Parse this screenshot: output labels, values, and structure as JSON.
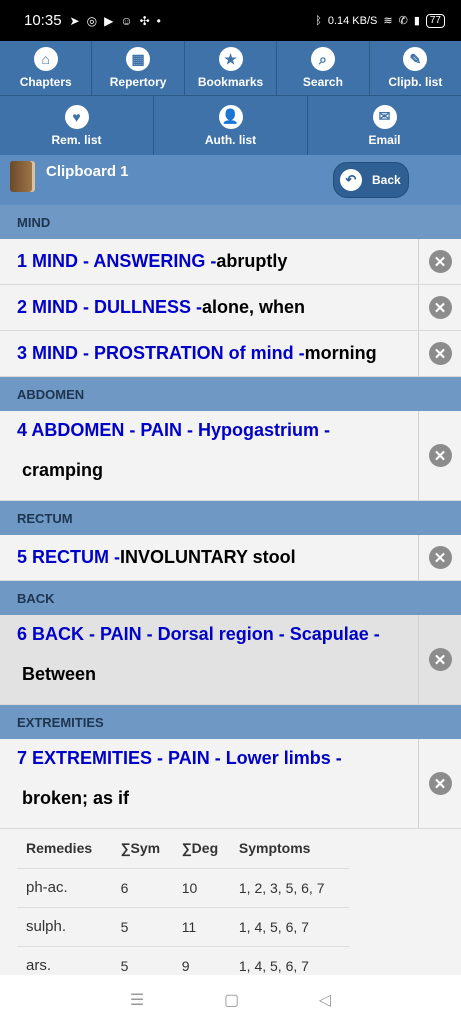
{
  "status": {
    "time": "10:35",
    "left_icons": [
      "send-icon",
      "instagram-icon",
      "youtube-icon",
      "snapchat-icon",
      "app-icon",
      "dot-icon"
    ],
    "net_speed": "0.14 KB/S",
    "battery": "77"
  },
  "nav": {
    "row1": [
      {
        "label": "Chapters",
        "icon": "home-icon",
        "glyph": "⌂"
      },
      {
        "label": "Repertory",
        "icon": "grid-icon",
        "glyph": "▦"
      },
      {
        "label": "Bookmarks",
        "icon": "star-icon",
        "glyph": "★"
      },
      {
        "label": "Search",
        "icon": "search-icon",
        "glyph": "⌕"
      },
      {
        "label": "Clipb. list",
        "icon": "pencil-icon",
        "glyph": "✎"
      }
    ],
    "row2": [
      {
        "label": "Rem. list",
        "icon": "heart-icon",
        "glyph": "♥"
      },
      {
        "label": "Auth. list",
        "icon": "person-icon",
        "glyph": "👤"
      },
      {
        "label": "Email",
        "icon": "mail-icon",
        "glyph": "✉"
      }
    ]
  },
  "clipboard": {
    "title": "Clipboard 1",
    "back_label": "Back"
  },
  "sections": [
    {
      "name": "MIND",
      "rows": [
        {
          "head": "1 MIND - ANSWERING - ",
          "tail": "abruptly",
          "layout": "single",
          "shaded": false
        },
        {
          "head": "2 MIND - DULLNESS - ",
          "tail": "alone, when",
          "layout": "single",
          "shaded": false
        },
        {
          "head": "3 MIND - PROSTRATION of mind - ",
          "tail": "morning",
          "layout": "single",
          "shaded": false
        }
      ]
    },
    {
      "name": "ABDOMEN",
      "rows": [
        {
          "head": "4 ABDOMEN - PAIN - Hypogastrium - ",
          "tail": "cramping",
          "layout": "double",
          "shaded": false
        }
      ]
    },
    {
      "name": "RECTUM",
      "rows": [
        {
          "head": "5 RECTUM - ",
          "tail": "INVOLUNTARY stool",
          "layout": "single",
          "shaded": false
        }
      ]
    },
    {
      "name": "BACK",
      "rows": [
        {
          "head": "6 BACK - PAIN - Dorsal region - Scapulae - ",
          "tail": "Between",
          "layout": "double",
          "shaded": true
        }
      ]
    },
    {
      "name": "EXTREMITIES",
      "rows": [
        {
          "head": "7 EXTREMITIES - PAIN - Lower limbs - ",
          "tail": "broken; as if",
          "layout": "double",
          "shaded": false
        }
      ]
    }
  ],
  "remedies": {
    "headers": [
      "Remedies",
      "∑Sym",
      "∑Deg",
      "Symptoms"
    ],
    "rows": [
      [
        "ph-ac.",
        "6",
        "10",
        "1, 2, 3, 5, 6, 7"
      ],
      [
        "sulph.",
        "5",
        "11",
        "1, 4, 5, 6, 7"
      ],
      [
        "ars.",
        "5",
        "9",
        "1, 4, 5, 6, 7"
      ]
    ]
  },
  "sysnav": [
    {
      "name": "recents-icon",
      "glyph": "☰"
    },
    {
      "name": "home-button-icon",
      "glyph": "▢"
    },
    {
      "name": "back-nav-icon",
      "glyph": "◁"
    }
  ]
}
